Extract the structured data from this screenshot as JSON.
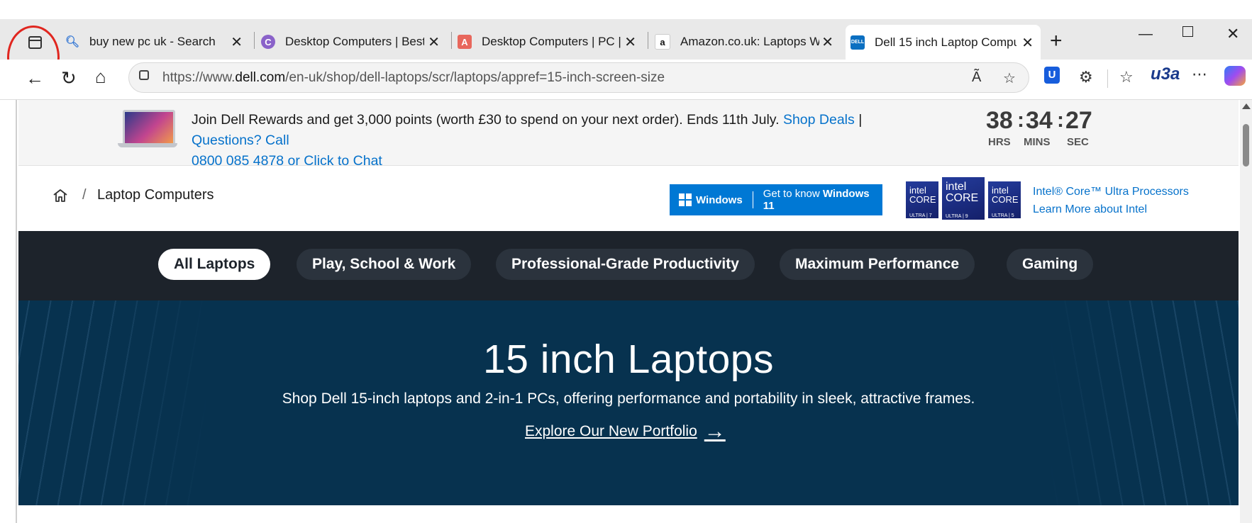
{
  "browser": {
    "tabs": [
      {
        "title": "buy new pc uk - Search",
        "favicon": "search-icon"
      },
      {
        "title": "Desktop Computers | Best",
        "favicon": "c-logo-icon"
      },
      {
        "title": "Desktop Computers | PC |",
        "favicon": "a-logo-icon"
      },
      {
        "title": "Amazon.co.uk: Laptops Wi",
        "favicon": "amazon-icon"
      },
      {
        "title": "Dell 15 inch Laptop Compu",
        "favicon": "dell-icon",
        "active": true
      }
    ],
    "url_prefix": "https://www.",
    "url_domain": "dell.com",
    "url_path": "/en-uk/shop/dell-laptops/scr/laptops/appref=15-inch-screen-size",
    "colors": {
      "annotation": "#e0261f",
      "bitwarden": "#175ddc"
    }
  },
  "promo": {
    "text": "Join Dell Rewards and get 3,000 points (worth £30 to spend on your next order). Ends 11th July.",
    "shop_deals": "Shop Deals",
    "separator": "|",
    "questions": "Questions? Call",
    "phone": "0800 085 4878 or Click to Chat",
    "countdown": {
      "hrs": "38",
      "mins": "34",
      "sec": "27",
      "hrs_label": "HRS",
      "mins_label": "MINS",
      "sec_label": "SEC"
    }
  },
  "breadcrumb": {
    "separator": "/",
    "current": "Laptop Computers"
  },
  "windows_banner": {
    "logo_label": "Windows",
    "cta_prefix": "Get to know ",
    "cta_bold": "Windows 11"
  },
  "intel": {
    "badges": [
      {
        "brand": "intel",
        "line": "CORE",
        "tier": "ULTRA | 7"
      },
      {
        "brand": "intel",
        "line": "CORE",
        "tier": "ULTRA | 9"
      },
      {
        "brand": "intel",
        "line": "CORE",
        "tier": "ULTRA | 5"
      }
    ],
    "link1": "Intel® Core™ Ultra Processors",
    "link2": "Learn More about Intel"
  },
  "categories": [
    "All Laptops",
    "Play, School & Work",
    "Professional-Grade Productivity",
    "Maximum Performance",
    "Gaming"
  ],
  "hero": {
    "title": "15 inch Laptops",
    "subtitle": "Shop Dell 15-inch laptops and 2-in-1 PCs, offering performance and portability in sleek, attractive frames.",
    "link": "Explore Our New Portfolio",
    "bg_color": "#07324f"
  }
}
